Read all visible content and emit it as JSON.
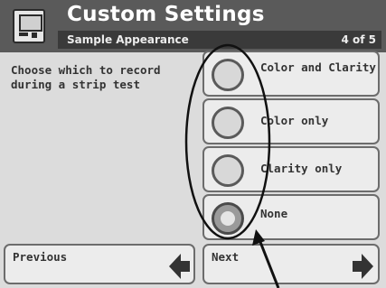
{
  "header": {
    "title": "Custom Settings",
    "subtitle": "Sample Appearance",
    "page_indicator": "4 of 5",
    "icon": "device-icon"
  },
  "instruction": "Choose which to record during a strip test",
  "options": [
    {
      "label": "Color and Clarity",
      "selected": false
    },
    {
      "label": "Color only",
      "selected": false
    },
    {
      "label": "Clarity only",
      "selected": false
    },
    {
      "label": "None",
      "selected": true
    }
  ],
  "nav": {
    "previous_label": "Previous",
    "next_label": "Next"
  },
  "colors": {
    "header_bg": "#5a5a5a",
    "subheader_bg": "#3a3a3a",
    "screen_bg": "#dcdcdc",
    "button_bg": "#ececec",
    "border": "#6c6c6c"
  }
}
